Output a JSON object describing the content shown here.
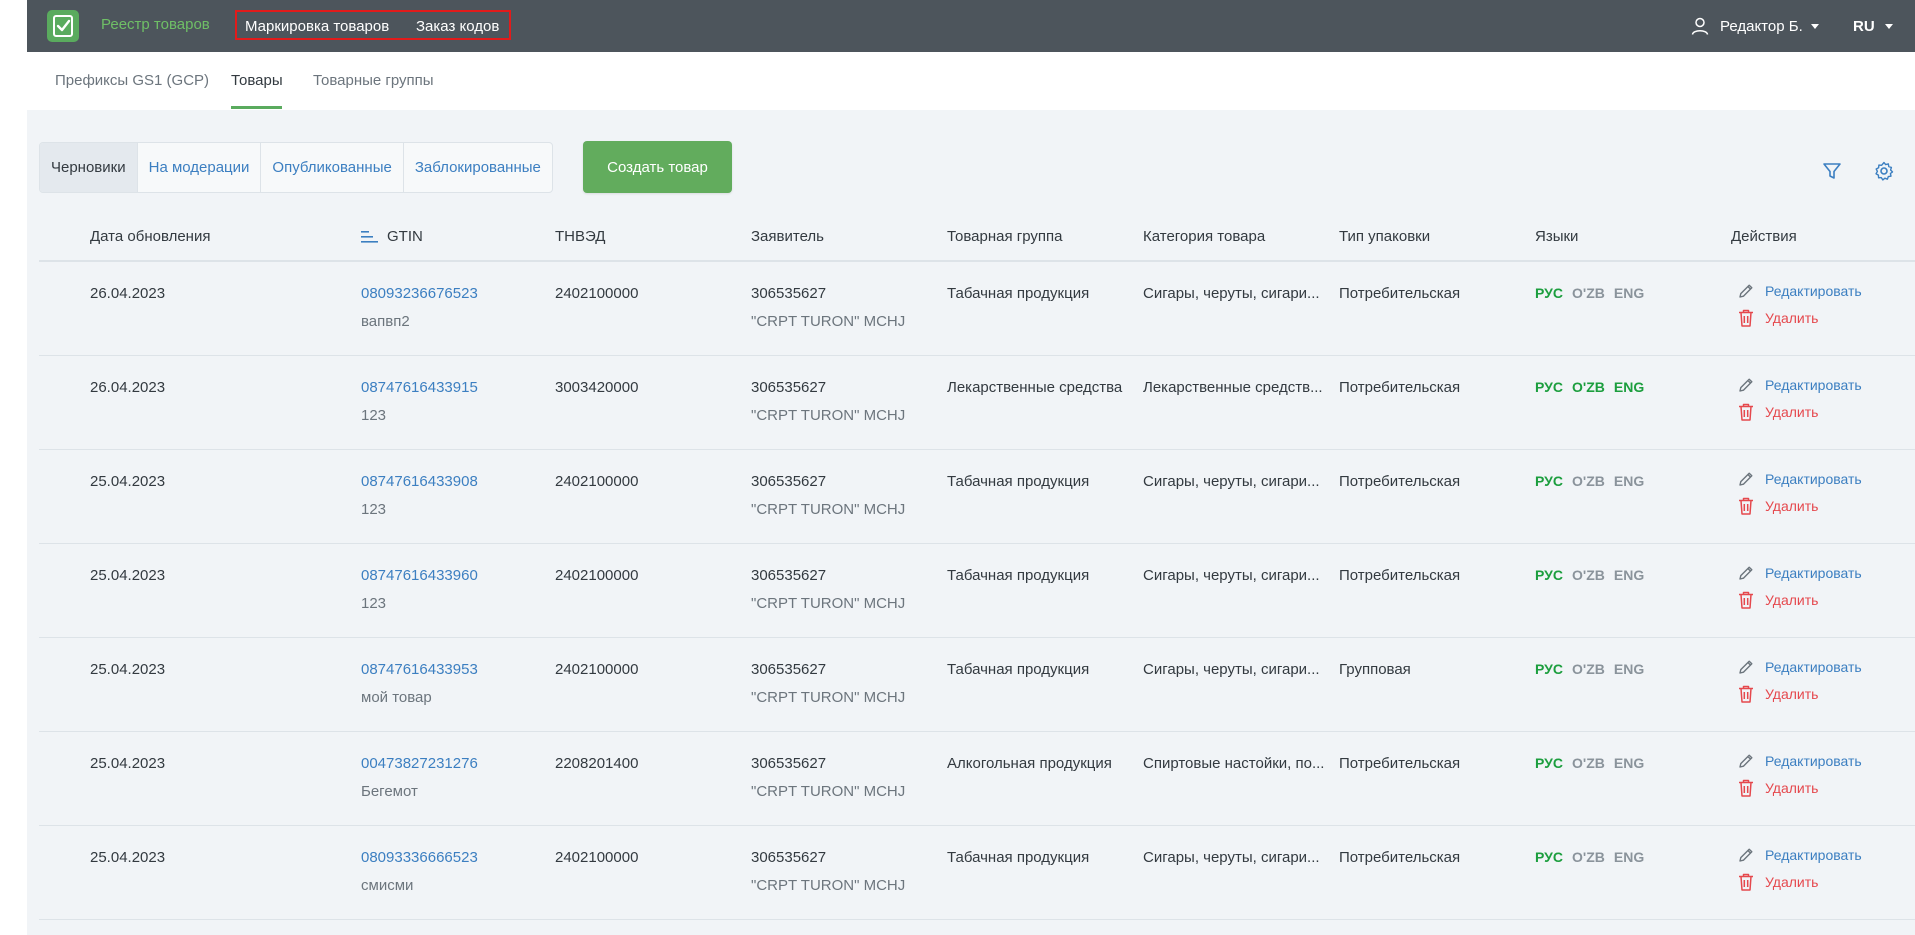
{
  "header": {
    "app_title": "Реестр товаров",
    "nav": [
      "Маркировка товаров",
      "Заказ кодов"
    ],
    "user_name": "Редактор Б.",
    "language": "RU"
  },
  "subtabs": [
    "Префиксы GS1 (GCP)",
    "Товары",
    "Товарные группы"
  ],
  "active_subtab": "Товары",
  "status_tabs": [
    "Черновики",
    "На модерации",
    "Опубликованные",
    "Заблокированные"
  ],
  "active_status": "Черновики",
  "create_button": "Создать товар",
  "table": {
    "columns": [
      "Дата обновления",
      "GTIN",
      "ТНВЭД",
      "Заявитель",
      "Товарная группа",
      "Категория товара",
      "Тип упаковки",
      "Языки",
      "Действия"
    ],
    "edit_label": "Редактировать",
    "delete_label": "Удалить",
    "rows": [
      {
        "date": "26.04.2023",
        "gtin": "08093236676523",
        "name": "вапвп2",
        "tnved": "2402100000",
        "inn": "306535627",
        "company": "\"CRPT TURON\" MCHJ",
        "group": "Табачная продукция",
        "category": "Сигары, черуты, сигари...",
        "package": "Потребительская",
        "langs": [
          {
            "code": "РУС",
            "active": true
          },
          {
            "code": "O'ZB",
            "active": false
          },
          {
            "code": "ENG",
            "active": false
          }
        ]
      },
      {
        "date": "26.04.2023",
        "gtin": "08747616433915",
        "name": "123",
        "tnved": "3003420000",
        "inn": "306535627",
        "company": "\"CRPT TURON\" MCHJ",
        "group": "Лекарственные средства",
        "category": "Лекарственные средств...",
        "package": "Потребительская",
        "langs": [
          {
            "code": "РУС",
            "active": true
          },
          {
            "code": "O'ZB",
            "active": true
          },
          {
            "code": "ENG",
            "active": true
          }
        ]
      },
      {
        "date": "25.04.2023",
        "gtin": "08747616433908",
        "name": "123",
        "tnved": "2402100000",
        "inn": "306535627",
        "company": "\"CRPT TURON\" MCHJ",
        "group": "Табачная продукция",
        "category": "Сигары, черуты, сигари...",
        "package": "Потребительская",
        "langs": [
          {
            "code": "РУС",
            "active": true
          },
          {
            "code": "O'ZB",
            "active": false
          },
          {
            "code": "ENG",
            "active": false
          }
        ]
      },
      {
        "date": "25.04.2023",
        "gtin": "08747616433960",
        "name": "123",
        "tnved": "2402100000",
        "inn": "306535627",
        "company": "\"CRPT TURON\" MCHJ",
        "group": "Табачная продукция",
        "category": "Сигары, черуты, сигари...",
        "package": "Потребительская",
        "langs": [
          {
            "code": "РУС",
            "active": true
          },
          {
            "code": "O'ZB",
            "active": false
          },
          {
            "code": "ENG",
            "active": false
          }
        ]
      },
      {
        "date": "25.04.2023",
        "gtin": "08747616433953",
        "name": "мой товар",
        "tnved": "2402100000",
        "inn": "306535627",
        "company": "\"CRPT TURON\" MCHJ",
        "group": "Табачная продукция",
        "category": "Сигары, черуты, сигари...",
        "package": "Групповая",
        "langs": [
          {
            "code": "РУС",
            "active": true
          },
          {
            "code": "O'ZB",
            "active": false
          },
          {
            "code": "ENG",
            "active": false
          }
        ]
      },
      {
        "date": "25.04.2023",
        "gtin": "00473827231276",
        "name": "Бегемот",
        "tnved": "2208201400",
        "inn": "306535627",
        "company": "\"CRPT TURON\" MCHJ",
        "group": "Алкогольная продукция",
        "category": "Спиртовые настойки, по...",
        "package": "Потребительская",
        "langs": [
          {
            "code": "РУС",
            "active": true
          },
          {
            "code": "O'ZB",
            "active": false
          },
          {
            "code": "ENG",
            "active": false
          }
        ]
      },
      {
        "date": "25.04.2023",
        "gtin": "08093336666523",
        "name": "смисми",
        "tnved": "2402100000",
        "inn": "306535627",
        "company": "\"CRPT TURON\" MCHJ",
        "group": "Табачная продукция",
        "category": "Сигары, черуты, сигари...",
        "package": "Потребительская",
        "langs": [
          {
            "code": "РУС",
            "active": true
          },
          {
            "code": "O'ZB",
            "active": false
          },
          {
            "code": "ENG",
            "active": false
          }
        ]
      }
    ]
  },
  "icons": {
    "logo": "checklist-icon",
    "user": "user-icon",
    "filter": "filter-icon",
    "settings": "gear-icon",
    "sort": "sort-icon",
    "edit": "pencil-icon",
    "delete": "trash-icon"
  },
  "colors": {
    "topbar": "#4d555c",
    "accent_green": "#5aab5e",
    "link_blue": "#3c7fc1",
    "delete_red": "#e5484d",
    "lang_active": "#1c9e3e",
    "lang_inactive": "#8a939b",
    "highlight_border": "#e21b1b"
  }
}
